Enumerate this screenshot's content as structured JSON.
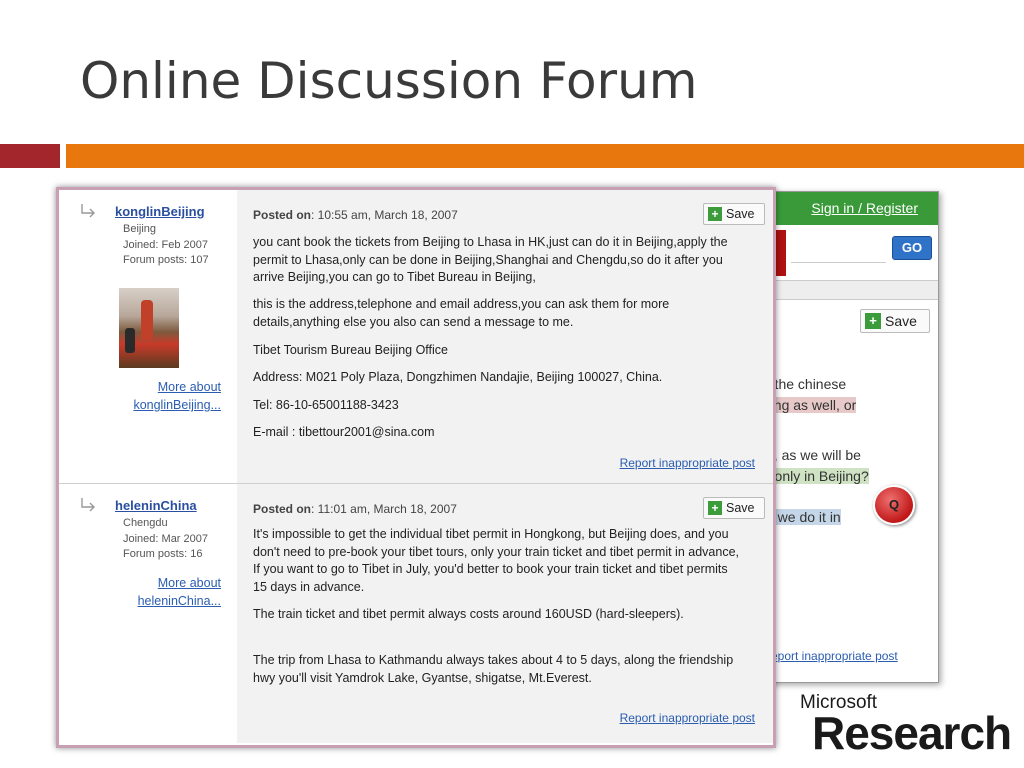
{
  "slide": {
    "title": "Online Discussion Forum"
  },
  "background_window": {
    "sign_in": "Sign in / Register",
    "go_button": "GO",
    "save_label": "Save",
    "fragments": [
      "r the chinese",
      "ong as well, or",
      "n, as we will be",
      "r only in Beijing?",
      "n we do it in"
    ],
    "report_link": "eport inappropriate post",
    "badge_text": "Q"
  },
  "posts": [
    {
      "author": "konglinBeijing",
      "location": "Beijing",
      "joined": "Joined: Feb 2007",
      "forum_posts": "Forum posts: 107",
      "more_about_1": "More about",
      "more_about_2": "konglinBeijing...",
      "posted_label": "Posted on",
      "posted_value": ": 10:55 am, March 18, 2007",
      "save_label": "Save",
      "paragraphs": [
        "you cant book the tickets from Beijing to Lhasa in HK,just can do it in Beijing,apply the permit to Lhasa,only can be done in Beijing,Shanghai and Chengdu,so do it after you arrive Beijing,you can go to Tibet Bureau in Beijing,",
        "this is the address,telephone and email address,you can ask them for more details,anything else you also can send a message  to me.",
        "Tibet Tourism Bureau Beijing Office",
        "Address: M021 Poly Plaza, Dongzhimen Nandajie, Beijing 100027, China.",
        "Tel: 86-10-65001188-3423",
        "E-mail : tibettour2001@sina.com"
      ],
      "report_link": "Report inappropriate post"
    },
    {
      "author": "heleninChina",
      "location": "Chengdu",
      "joined": "Joined: Mar 2007",
      "forum_posts": "Forum posts: 16",
      "more_about_1": "More about",
      "more_about_2": "heleninChina...",
      "posted_label": "Posted on",
      "posted_value": ": 11:01 am, March 18, 2007",
      "save_label": "Save",
      "paragraphs": [
        "It's impossible  to get the individual tibet permit in Hongkong, but Beijing does, and you don't need to pre-book your tibet tours, only your train ticket and tibet permit in advance, If you want to go to Tibet in July, you'd better to book your train ticket and tibet permits 15 days in advance.",
        "  The train ticket and tibet permit always costs around 160USD (hard-sleepers).",
        "The trip from Lhasa to Kathmandu always takes about 4 to 5 days, along the friendship hwy you'll visit Yamdrok Lake, Gyantse, shigatse, Mt.Everest."
      ],
      "report_link": "Report inappropriate post"
    }
  ],
  "logo": {
    "line1": "Microsoft",
    "line2": "Research"
  },
  "colors": {
    "accent_red": "#a2262b",
    "accent_orange": "#e8780e",
    "link_blue": "#2a5db0",
    "green_bar": "#3a9a3a"
  }
}
